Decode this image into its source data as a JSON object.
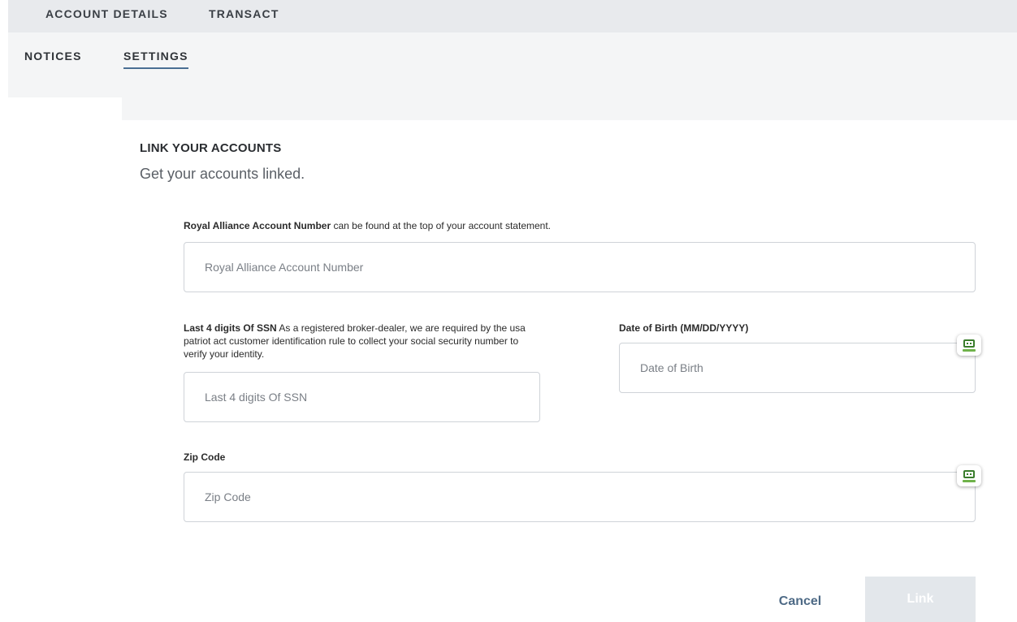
{
  "top_nav": {
    "tabs": [
      {
        "label": "ACCOUNT DETAILS"
      },
      {
        "label": "TRANSACT"
      }
    ]
  },
  "sub_nav": {
    "tabs": [
      {
        "label": "NOTICES",
        "active": false
      },
      {
        "label": "SETTINGS",
        "active": true
      }
    ]
  },
  "card": {
    "title": "LINK YOUR ACCOUNTS",
    "subtitle": "Get your accounts linked."
  },
  "account_number": {
    "label_bold": "Royal Alliance Account Number",
    "label_rest": " can be found at the top of your account statement.",
    "placeholder": "Royal Alliance Account Number",
    "value": ""
  },
  "ssn": {
    "label_bold": "Last 4 digits Of SSN",
    "label_rest": " As a registered broker-dealer, we are required by the usa patriot act customer identification rule to collect your social security number to verify your identity.",
    "placeholder": "Last 4 digits Of SSN",
    "value": ""
  },
  "dob": {
    "label": "Date of Birth (MM/DD/YYYY)",
    "placeholder": "Date of Birth",
    "value": ""
  },
  "zip": {
    "label": "Zip Code",
    "placeholder": "Zip Code",
    "value": ""
  },
  "actions": {
    "cancel_label": "Cancel",
    "link_label": "Link"
  },
  "colors": {
    "active_tab_underline": "#4a6e93",
    "cancel_text": "#4e6a86",
    "link_button_bg": "#e3e7eb",
    "password_icon": "#3a7d2c"
  },
  "icons": [
    "password-manager-icon"
  ]
}
